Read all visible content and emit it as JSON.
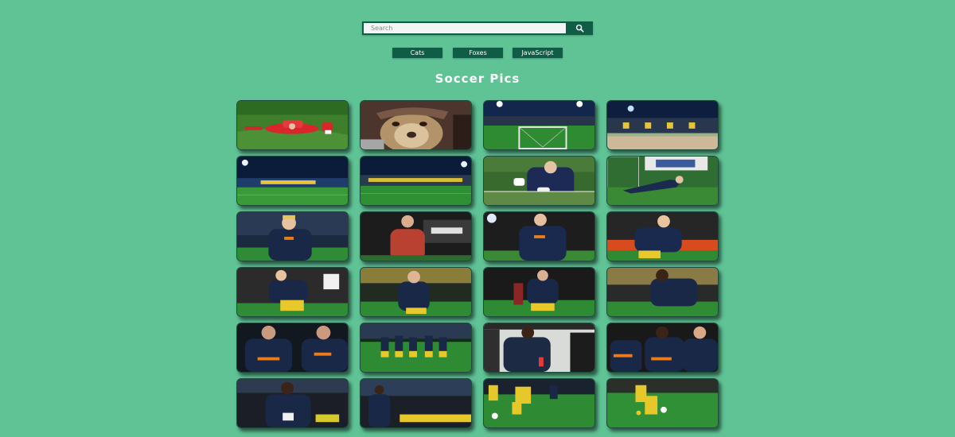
{
  "search": {
    "placeholder": "Search",
    "icon": "search-icon"
  },
  "categories": [
    {
      "label": "Cats"
    },
    {
      "label": "Foxes"
    },
    {
      "label": "JavaScript"
    }
  ],
  "title": "Soccer Pics",
  "colors": {
    "background": "#5fc396",
    "accent": "#0f5d45"
  },
  "gallery": [
    {
      "name": "photo-player-down"
    },
    {
      "name": "photo-lion-mascot"
    },
    {
      "name": "photo-stadium-goal"
    },
    {
      "name": "photo-stadium-stand"
    },
    {
      "name": "photo-stadium-night-1"
    },
    {
      "name": "photo-stadium-night-2"
    },
    {
      "name": "photo-goalkeeper-gloves"
    },
    {
      "name": "photo-goalkeeper-dive"
    },
    {
      "name": "photo-player-warmup-1"
    },
    {
      "name": "photo-coach-red"
    },
    {
      "name": "photo-player-warmup-2"
    },
    {
      "name": "photo-player-warmup-3"
    },
    {
      "name": "photo-player-running-1"
    },
    {
      "name": "photo-player-walking"
    },
    {
      "name": "photo-player-running-2"
    },
    {
      "name": "photo-player-running-3"
    },
    {
      "name": "photo-players-group-1"
    },
    {
      "name": "photo-team-warmup"
    },
    {
      "name": "photo-player-back"
    },
    {
      "name": "photo-players-group-2"
    },
    {
      "name": "photo-player-bench-1"
    },
    {
      "name": "photo-player-bench-2"
    },
    {
      "name": "photo-players-training-1"
    },
    {
      "name": "photo-players-training-2"
    }
  ]
}
